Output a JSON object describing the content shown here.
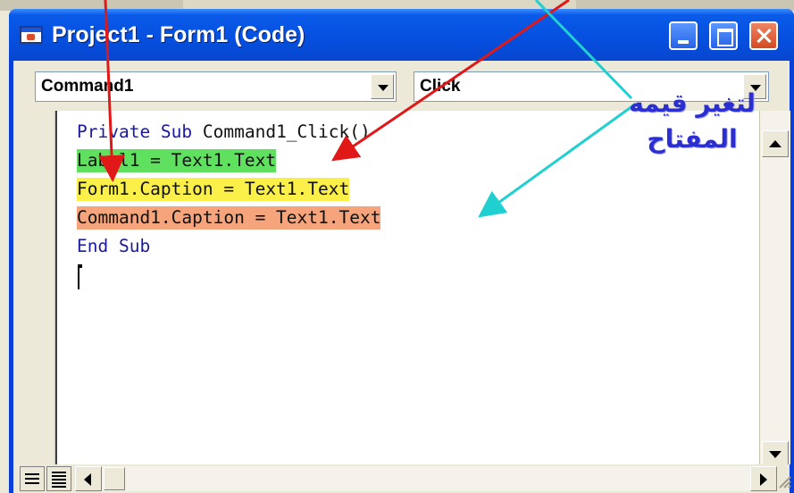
{
  "window": {
    "title": "Project1 - Form1 (Code)",
    "title_icon": "code-window-icon",
    "controls": [
      "minimize-icon",
      "maximize-icon",
      "close-icon"
    ]
  },
  "toolbar": {
    "object_combo": {
      "value": "Command1"
    },
    "procedure_combo": {
      "value": "Click"
    }
  },
  "code": {
    "lines": [
      {
        "segments": [
          {
            "text": "Private Sub ",
            "style": "keyword"
          },
          {
            "text": "Command1_Click()",
            "style": "plain"
          }
        ]
      },
      {
        "text": "Label1 = Text1.Text",
        "highlight": "#5fe05f"
      },
      {
        "text": "Form1.Caption = Text1.Text",
        "highlight": "#fbf04a"
      },
      {
        "text": "Command1.Caption = Text1.Text",
        "highlight": "#f5a47b"
      },
      {
        "text": "End Sub",
        "style": "keyword"
      }
    ]
  },
  "annotation": {
    "line1": "لتغير قيمه",
    "line2": "المفتاح",
    "text_color": "#2b2fd0",
    "arrow_colors": [
      "#e01818",
      "#20d0d0"
    ]
  },
  "footer": {
    "view_buttons": [
      "procedure-view-icon",
      "full-module-view-icon"
    ],
    "scroll_icons": [
      "scroll-left-icon",
      "scroll-right-icon",
      "scroll-up-icon",
      "scroll-down-icon"
    ]
  }
}
